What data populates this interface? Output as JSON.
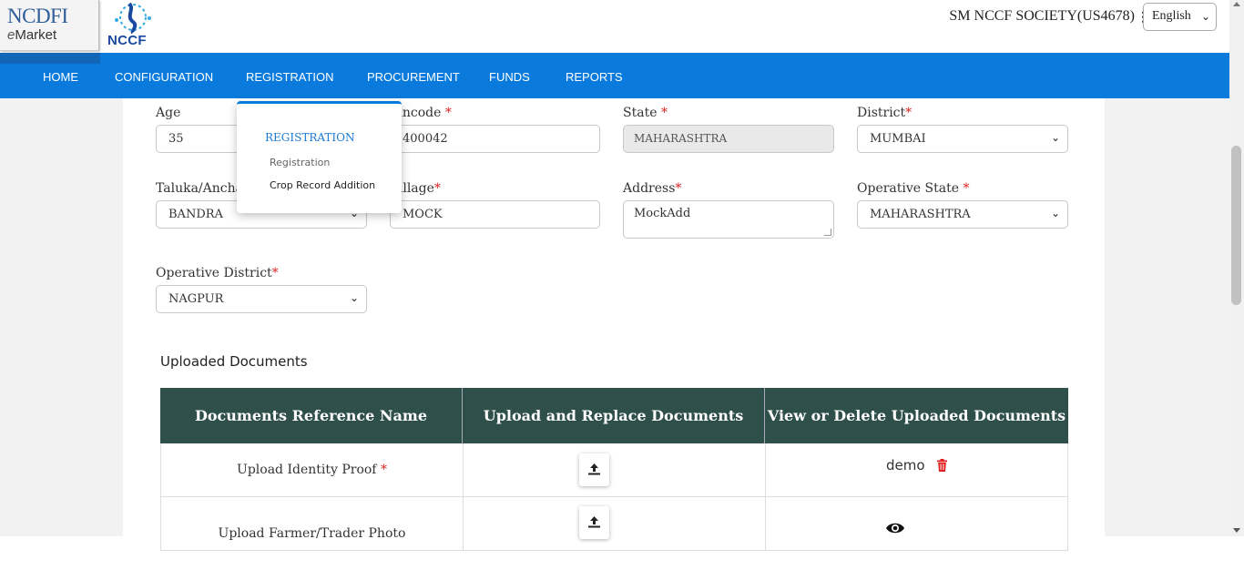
{
  "header": {
    "logo_ncdfi_line1": "NCDFI",
    "logo_ncdfi_line2_prefix": "e",
    "logo_ncdfi_line2": "Market",
    "logo_nccf": "NCCF",
    "user": "SM NCCF SOCIETY(US4678)",
    "language": "English"
  },
  "nav": {
    "items": [
      "HOME",
      "CONFIGURATION",
      "REGISTRATION",
      "PROCUREMENT",
      "FUNDS",
      "REPORTS"
    ]
  },
  "dropdown": {
    "heading": "REGISTRATION",
    "items": [
      "Registration",
      "Crop Record Addition"
    ]
  },
  "form": {
    "age_label": "Age",
    "age_value": "35",
    "pincode_label": "Pincode",
    "pincode_value": "400042",
    "state_label": "State",
    "state_value": "MAHARASHTRA",
    "district_label": "District",
    "district_value": "MUMBAI",
    "taluka_label": "Taluka/Anchal",
    "taluka_value": "BANDRA",
    "village_label": "Village",
    "village_value": "MOCK",
    "address_label": "Address",
    "address_value": "MockAdd",
    "op_state_label": "Operative State",
    "op_state_value": "MAHARASHTRA",
    "op_district_label": "Operative District",
    "op_district_value": "NAGPUR",
    "required_mark": "*"
  },
  "documents": {
    "title": "Uploaded Documents",
    "columns": [
      "Documents Reference Name",
      "Upload and Replace Documents",
      "View or Delete Uploaded Documents"
    ],
    "rows": [
      {
        "name": "Upload Identity Proof",
        "file": "demo"
      },
      {
        "name": "Upload Farmer/Trader Photo",
        "file": ""
      }
    ]
  },
  "colors": {
    "nav": "#0a7bdc",
    "table_header": "#2f4f4a",
    "required": "#e02020",
    "delete": "#e02020"
  }
}
